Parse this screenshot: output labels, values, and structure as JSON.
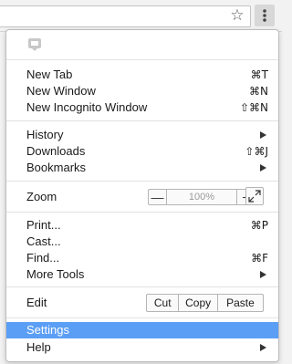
{
  "menu": {
    "groups": [
      {
        "items": [
          {
            "label": "New Tab",
            "shortcut": "⌘T"
          },
          {
            "label": "New Window",
            "shortcut": "⌘N"
          },
          {
            "label": "New Incognito Window",
            "shortcut": "⇧⌘N"
          }
        ]
      },
      {
        "items": [
          {
            "label": "History",
            "submenu": true
          },
          {
            "label": "Downloads",
            "shortcut": "⇧⌘J"
          },
          {
            "label": "Bookmarks",
            "submenu": true
          }
        ]
      },
      {
        "items": [
          {
            "label": "Zoom",
            "zoom_value": "100%",
            "minus": "—",
            "plus": "+"
          }
        ]
      },
      {
        "items": [
          {
            "label": "Print...",
            "shortcut": "⌘P"
          },
          {
            "label": "Cast..."
          },
          {
            "label": "Find...",
            "shortcut": "⌘F"
          },
          {
            "label": "More Tools",
            "submenu": true
          }
        ]
      },
      {
        "items": [
          {
            "label": "Edit",
            "cut": "Cut",
            "copy": "Copy",
            "paste": "Paste"
          }
        ]
      },
      {
        "items": [
          {
            "label": "Settings",
            "selected": true
          },
          {
            "label": "Help",
            "submenu": true
          }
        ]
      }
    ]
  },
  "toolbar": {
    "star_icon": "star-icon",
    "menu_icon": "three-dot-menu-icon"
  },
  "colors": {
    "selected_bg": "#5b9ef5",
    "toolbar_bg": "#f2f2f2"
  }
}
